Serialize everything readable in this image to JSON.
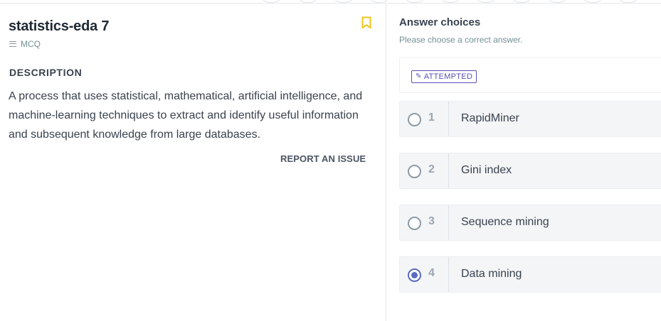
{
  "question": {
    "title": "statistics-eda 7",
    "type": "MCQ",
    "type_icon": "list-icon",
    "bookmark_icon": "bookmark-icon",
    "bookmark_color": "#f5c518",
    "description_heading": "DESCRIPTION",
    "description": "A process that uses statistical, mathematical, artificial intelligence, and machine-learning techniques to extract and identify useful information and subsequent knowledge from large databases.",
    "report_label": "REPORT AN ISSUE"
  },
  "answers": {
    "heading": "Answer choices",
    "subheading": "Please choose a correct answer.",
    "status_badge": "ATTEMPTED",
    "status_color": "#5a4fb3",
    "selected_index": 4,
    "options": [
      {
        "number": "1",
        "label": "RapidMiner"
      },
      {
        "number": "2",
        "label": "Gini index"
      },
      {
        "number": "3",
        "label": "Sequence mining"
      },
      {
        "number": "4",
        "label": "Data mining"
      }
    ]
  }
}
